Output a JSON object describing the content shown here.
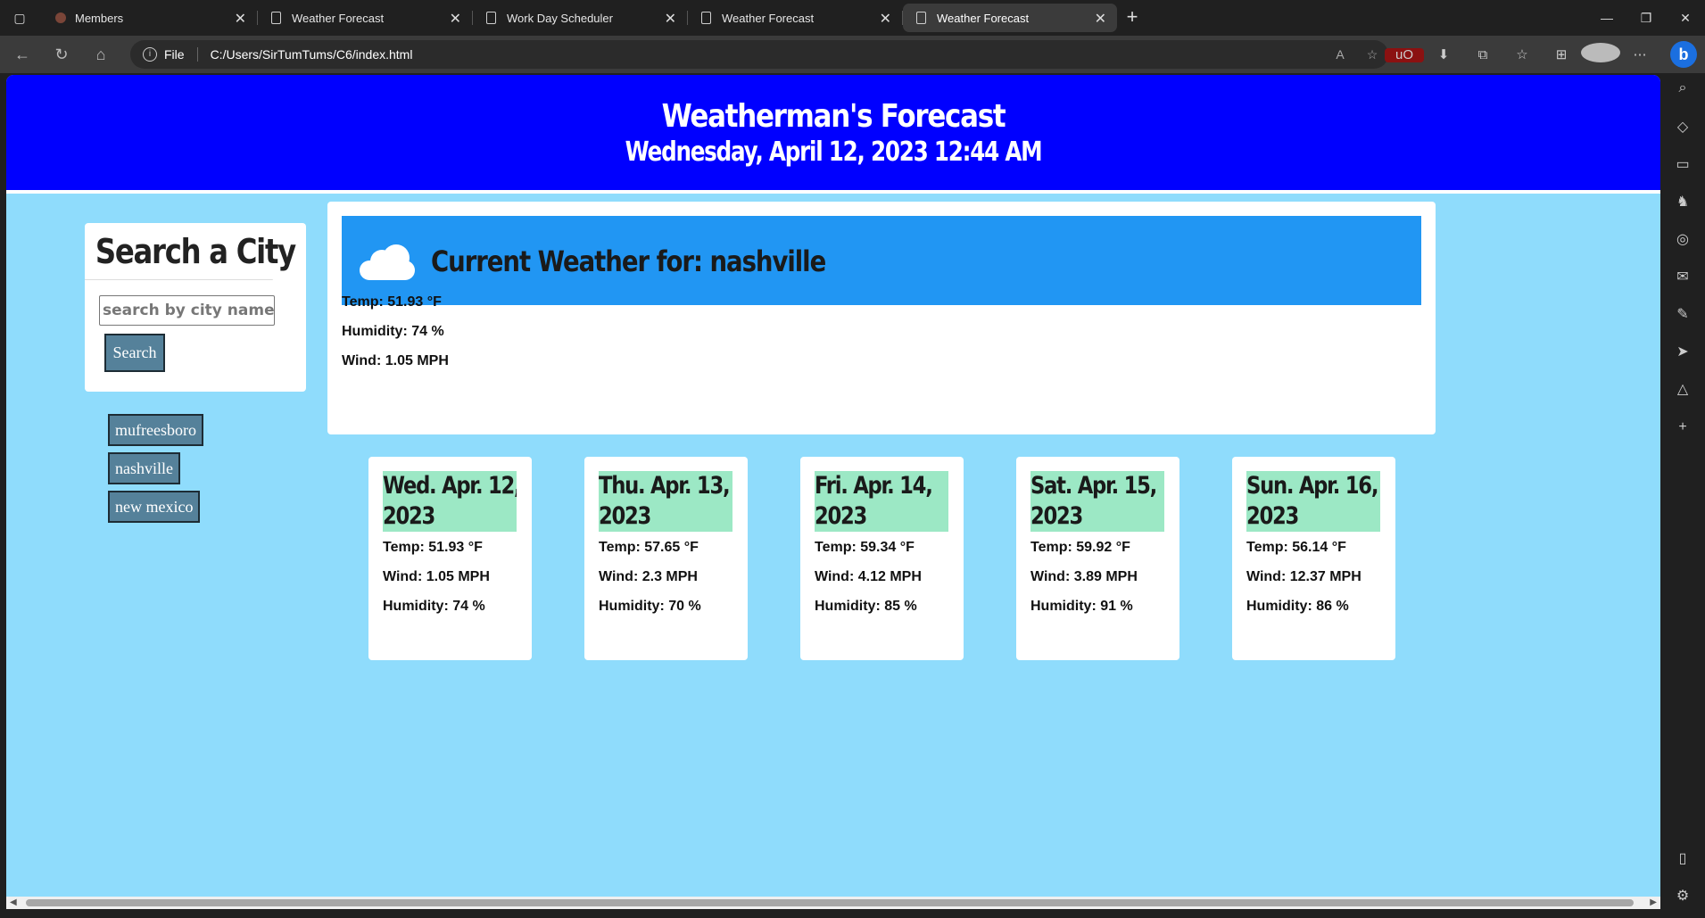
{
  "browser": {
    "tabs": [
      {
        "title": "Members",
        "icon": "favicon-dot"
      },
      {
        "title": "Weather Forecast",
        "icon": "page-icon"
      },
      {
        "title": "Work Day Scheduler",
        "icon": "page-icon"
      },
      {
        "title": "Weather Forecast",
        "icon": "page-icon"
      },
      {
        "title": "Weather Forecast",
        "icon": "page-icon",
        "active": true
      }
    ],
    "address": {
      "scheme_label": "File",
      "url": "C:/Users/SirTumTums/C6/index.html"
    }
  },
  "header": {
    "title": "Weatherman's Forecast",
    "datetime": "Wednesday, April 12, 2023 12:44 AM",
    "background": "#0000ff"
  },
  "search": {
    "title": "Search a City",
    "placeholder": "search by city name",
    "button_label": "Search"
  },
  "history": [
    "mufreesboro",
    "nashville",
    "new mexico"
  ],
  "current": {
    "heading": "Current Weather for: nashville",
    "icon": "cloud-icon",
    "temp": "Temp: 51.93 °F",
    "humidity": "Humidity: 74 %",
    "wind": "Wind: 1.05 MPH"
  },
  "forecast": [
    {
      "date_line1": "Wed. Apr. 12,",
      "date_line2": "2023",
      "temp": "Temp: 51.93 °F",
      "wind": "Wind: 1.05 MPH",
      "humidity": "Humidity: 74 %"
    },
    {
      "date_line1": "Thu. Apr. 13,",
      "date_line2": "2023",
      "temp": "Temp: 57.65 °F",
      "wind": "Wind: 2.3 MPH",
      "humidity": "Humidity: 70 %"
    },
    {
      "date_line1": "Fri. Apr. 14,",
      "date_line2": "2023",
      "temp": "Temp: 59.34 °F",
      "wind": "Wind: 4.12 MPH",
      "humidity": "Humidity: 85 %"
    },
    {
      "date_line1": "Sat. Apr. 15,",
      "date_line2": "2023",
      "temp": "Temp: 59.92 °F",
      "wind": "Wind: 3.89 MPH",
      "humidity": "Humidity: 91 %"
    },
    {
      "date_line1": "Sun. Apr. 16,",
      "date_line2": "2023",
      "temp": "Temp: 56.14 °F",
      "wind": "Wind: 12.37 MPH",
      "humidity": "Humidity: 86 %"
    }
  ],
  "colors": {
    "page_bg": "#8fdcfc",
    "current_bar": "#2196f3",
    "forecast_date_bg": "#9ce8c5",
    "button_bg": "#55819a"
  }
}
